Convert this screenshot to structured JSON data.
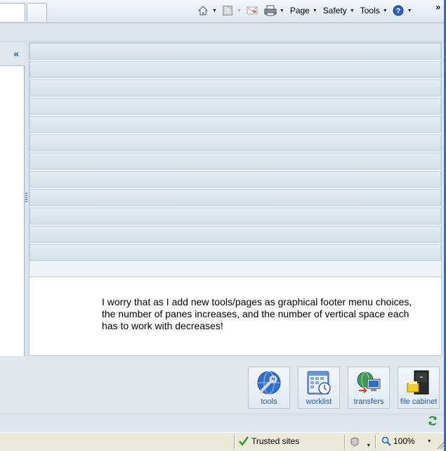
{
  "command_bar": {
    "page_label": "Page",
    "safety_label": "Safety",
    "tools_label": "Tools",
    "overflow": "»",
    "icons": [
      "home-icon",
      "feeds-icon",
      "mail-icon",
      "print-icon",
      "help-icon"
    ]
  },
  "left_pane": {
    "collapse_glyph": "«"
  },
  "right_pane": {
    "message": "I worry that as I add new tools/pages as graphical footer menu choices, the number of panes increases, and the number of vertical space each has to work with decreases!"
  },
  "footer_menu": {
    "items": [
      {
        "label": "tools",
        "icon": "wrench-globe-icon"
      },
      {
        "label": "worklist",
        "icon": "calendar-icon"
      },
      {
        "label": "transfers",
        "icon": "network-computers-icon"
      },
      {
        "label": "file cabinet",
        "icon": "file-cabinet-icon"
      }
    ]
  },
  "status_bar": {
    "zone": "Trusted sites",
    "zoom": "100%"
  },
  "colors": {
    "accent": "#1f5fb5",
    "tile_label": "#2b5d9b",
    "status_bg": "#ece9d8"
  }
}
